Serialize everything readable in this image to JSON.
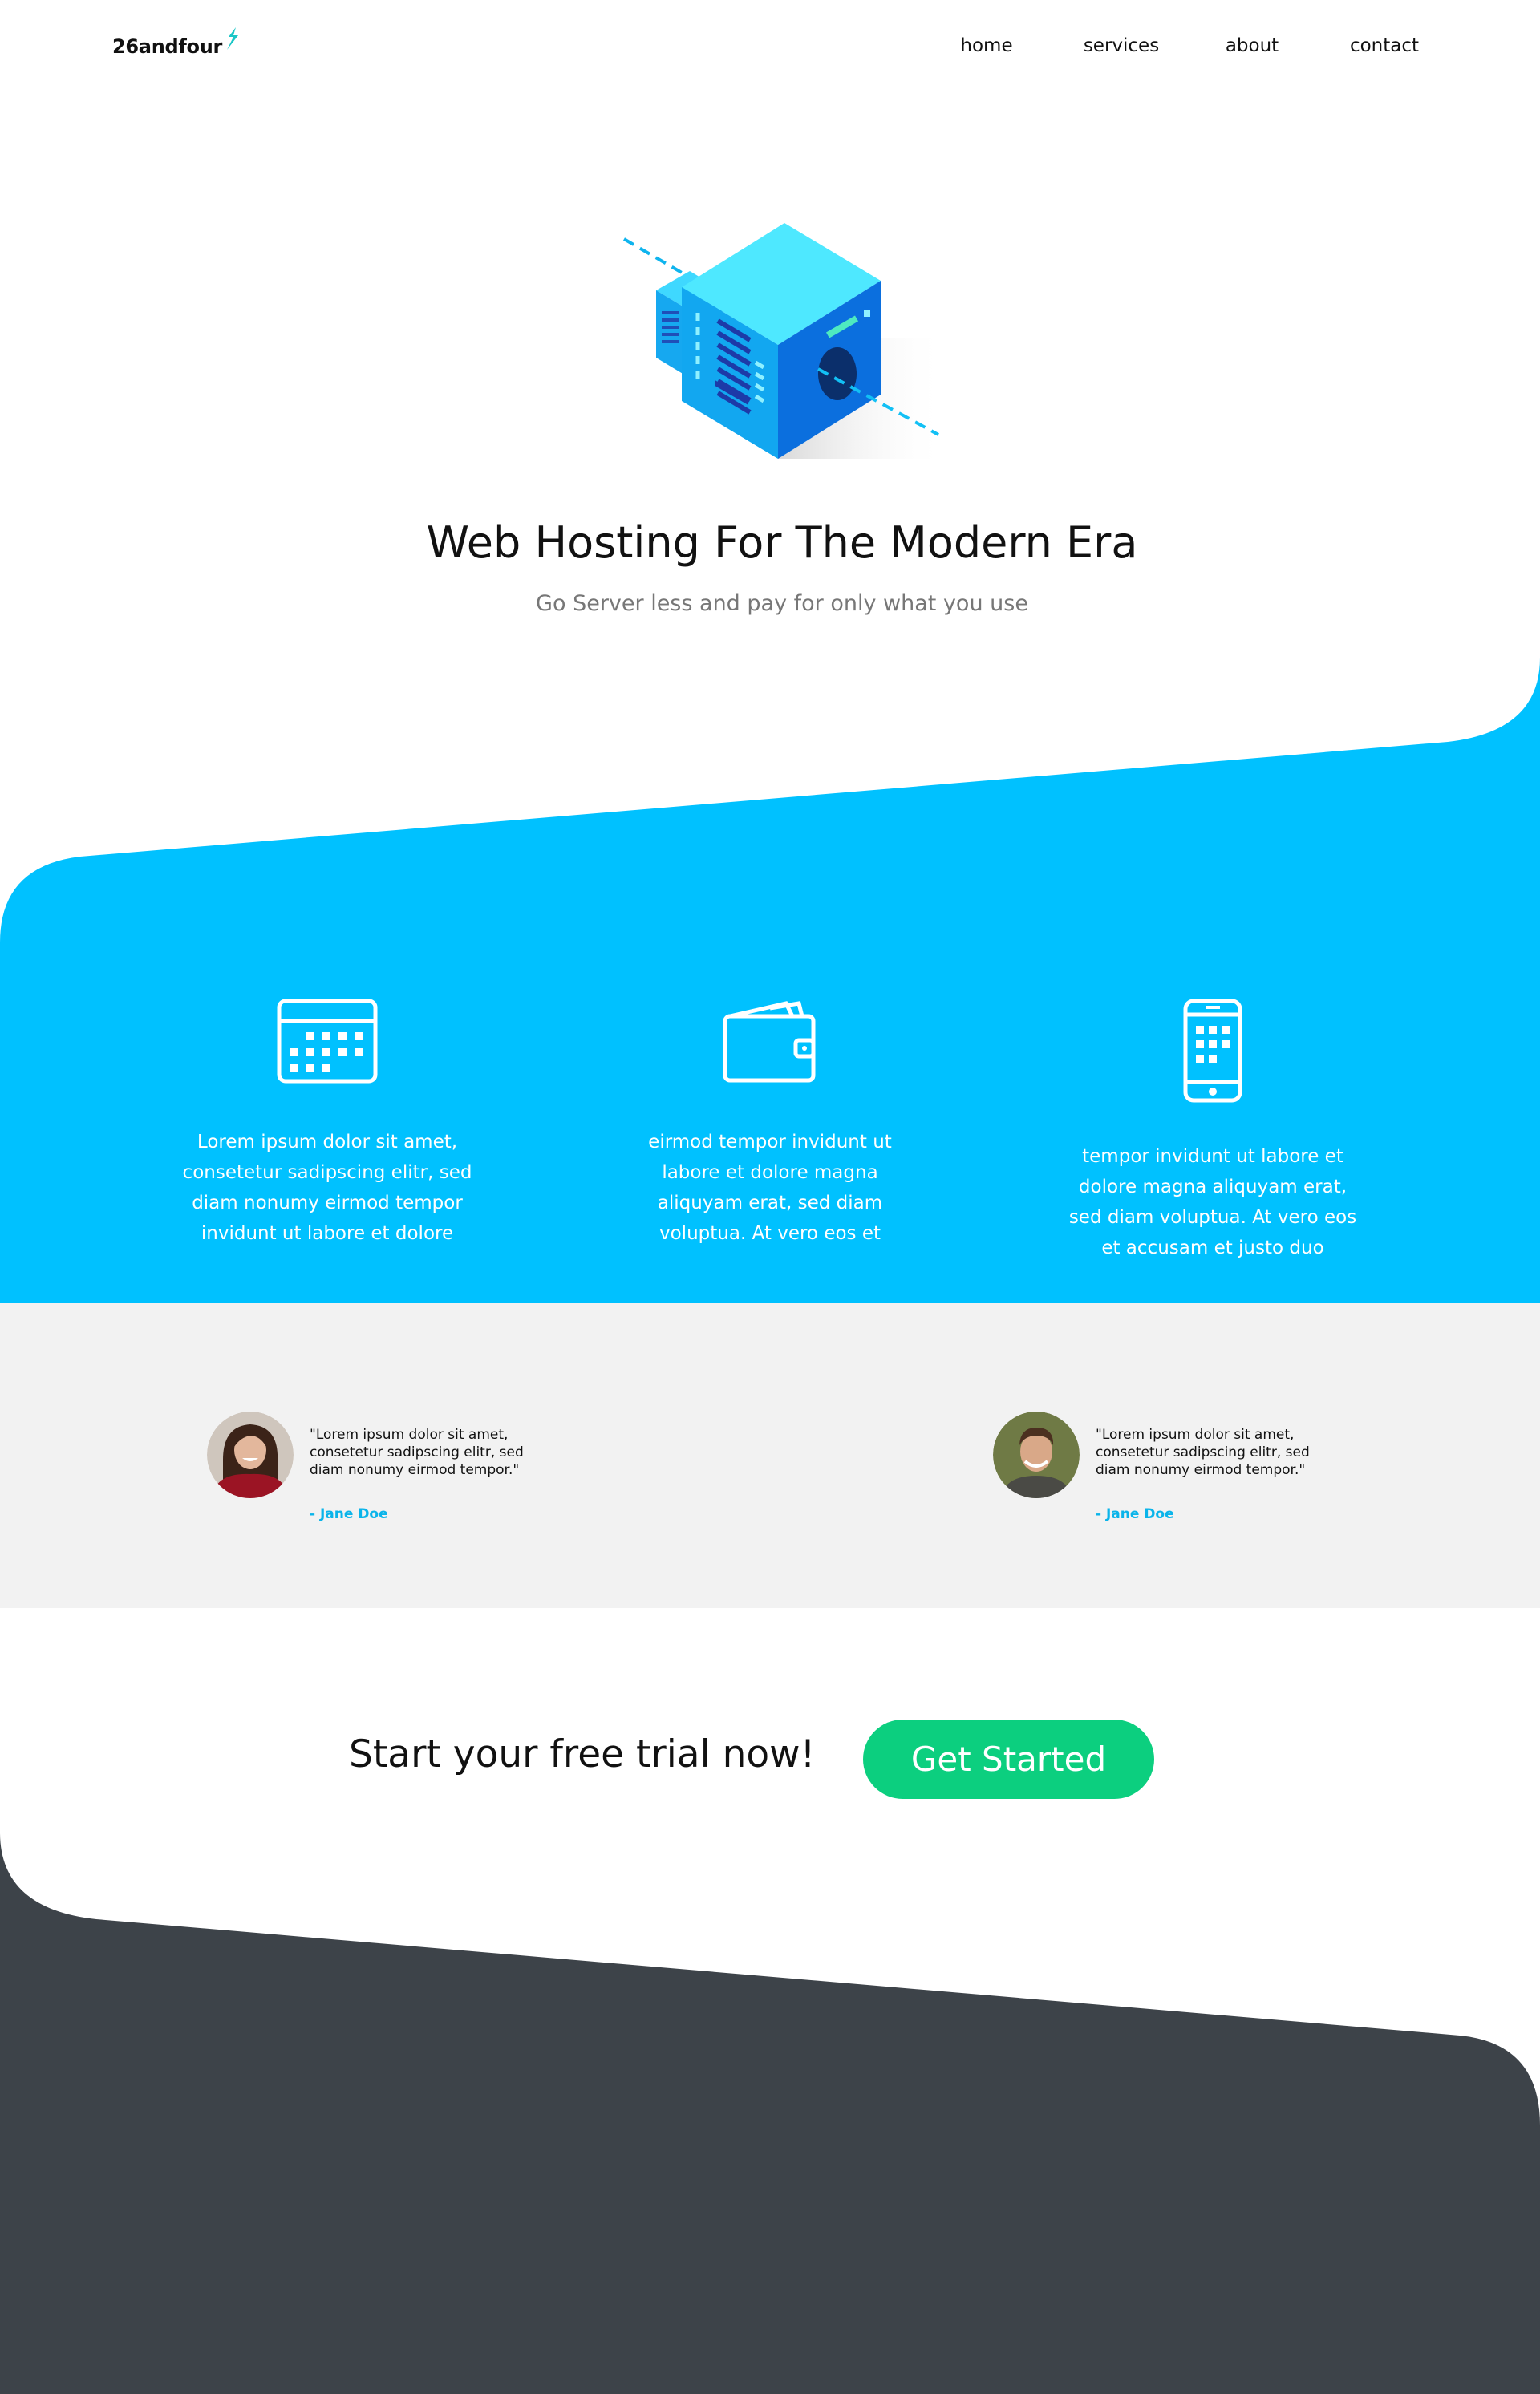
{
  "header": {
    "logo_text": "26andfour",
    "nav": [
      {
        "label": "home"
      },
      {
        "label": "services"
      },
      {
        "label": "about"
      },
      {
        "label": "contact"
      }
    ]
  },
  "hero": {
    "title": "Web Hosting For The Modern Era",
    "subtitle": "Go Server less and pay for only what you use",
    "image_icon": "isometric-server-icon"
  },
  "features": [
    {
      "icon": "calendar-icon",
      "text": "Lorem ipsum dolor sit amet, consetetur sadipscing elitr, sed diam nonumy eirmod tempor invidunt ut labore et dolore"
    },
    {
      "icon": "wallet-icon",
      "text": "eirmod tempor invidunt ut labore et dolore magna aliquyam erat, sed diam voluptua. At vero eos et"
    },
    {
      "icon": "smartphone-icon",
      "text": "tempor invidunt ut labore et dolore magna aliquyam erat, sed diam voluptua. At vero eos et accusam et justo duo"
    }
  ],
  "testimonials": [
    {
      "quote": "\"Lorem ipsum dolor sit amet, consetetur sadipscing elitr, sed diam nonumy eirmod tempor.\"",
      "author": "- Jane Doe"
    },
    {
      "quote": "\"Lorem ipsum dolor sit amet, consetetur sadipscing elitr, sed diam nonumy eirmod tempor.\"",
      "author": "- Jane Doe"
    }
  ],
  "cta": {
    "text": "Start your free trial now!",
    "button_label": "Get Started"
  },
  "colors": {
    "accent_blue": "#00c1ff",
    "cta_green": "#0ccf7f",
    "testimonial_bg": "#f2f2f2",
    "footer_dark": "#3d4349"
  }
}
